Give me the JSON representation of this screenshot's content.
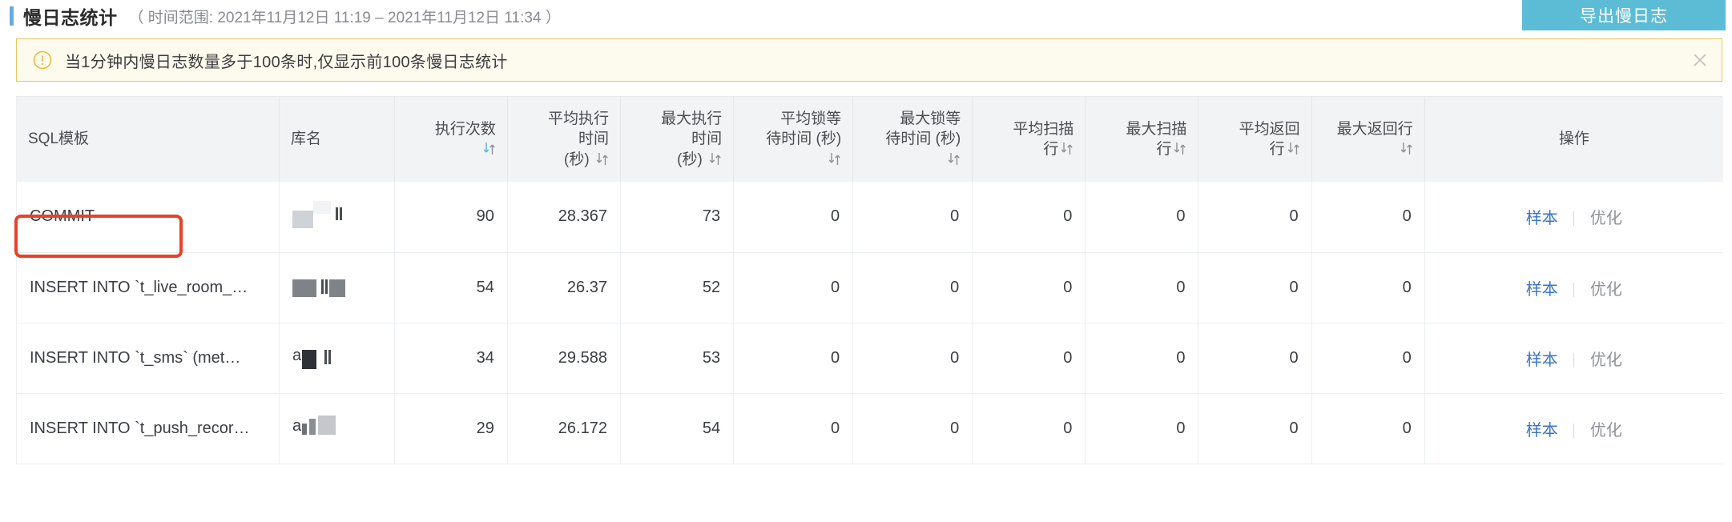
{
  "header": {
    "title": "慢日志统计",
    "time_range": "（ 时间范围: 2021年11月12日 11:19 – 2021年11月12日 11:34 ）",
    "export_label": "导出慢日志",
    "accent_color": "#6aa9e0",
    "export_button_color": "#5cbcd6"
  },
  "warning": {
    "icon": "exclamation-circle-icon",
    "text": "当1分钟内慢日志数量多于100条时,仅显示前100条慢日志统计",
    "close_icon": "close-icon",
    "background": "#fdfaee",
    "border_color": "#e6c75e",
    "icon_color": "#e8b93b"
  },
  "table": {
    "columns": [
      {
        "label": "SQL模板",
        "align": "left",
        "sortable": false,
        "sort_state": "none"
      },
      {
        "label": "库名",
        "align": "left",
        "sortable": false,
        "sort_state": "none"
      },
      {
        "label": "执行次数",
        "align": "right",
        "sortable": true,
        "sort_state": "desc"
      },
      {
        "label": "平均执行时间(秒)",
        "align": "right",
        "sortable": true,
        "sort_state": "none"
      },
      {
        "label": "最大执行时间(秒)",
        "align": "right",
        "sortable": true,
        "sort_state": "none"
      },
      {
        "label": "平均锁等待时间 (秒)",
        "align": "right",
        "sortable": true,
        "sort_state": "none"
      },
      {
        "label": "最大锁等待时间 (秒)",
        "align": "right",
        "sortable": true,
        "sort_state": "none"
      },
      {
        "label": "平均扫描行",
        "align": "right",
        "sortable": true,
        "sort_state": "none"
      },
      {
        "label": "最大扫描行",
        "align": "right",
        "sortable": true,
        "sort_state": "none"
      },
      {
        "label": "平均返回行",
        "align": "right",
        "sortable": true,
        "sort_state": "none"
      },
      {
        "label": "最大返回行",
        "align": "right",
        "sortable": true,
        "sort_state": "none"
      },
      {
        "label": "操作",
        "align": "center",
        "sortable": false,
        "sort_state": "none"
      }
    ],
    "column_lines": {
      "avg_exec_time_l1": "平均执行",
      "avg_exec_time_l2": "时间",
      "avg_exec_time_l3": "(秒)",
      "max_exec_time_l1": "最大执行",
      "max_exec_time_l2": "时间",
      "max_exec_time_l3": "(秒)",
      "avg_lock_l1": "平均锁等",
      "avg_lock_l2": "待时间 (秒)",
      "max_lock_l1": "最大锁等",
      "max_lock_l2": "待时间 (秒)",
      "avg_scan_l1": "平均扫描",
      "avg_scan_l2": "行",
      "max_scan_l1": "最大扫描",
      "max_scan_l2": "行",
      "avg_ret_l1": "平均返回",
      "avg_ret_l2": "行",
      "max_ret_l1": "最大返回行"
    },
    "actions": {
      "sample_label": "样本",
      "optimize_label": "优化",
      "sample_color": "#3b74c4",
      "optimize_color": "#8f9398"
    },
    "rows": [
      {
        "sql_template": "COMMIT",
        "db_name": "",
        "exec_count": "90",
        "avg_exec_time": "28.367",
        "max_exec_time": "73",
        "avg_lock_wait": "0",
        "max_lock_wait": "0",
        "avg_scan_rows": "0",
        "max_scan_rows": "0",
        "avg_return_rows": "0",
        "max_return_rows": "0",
        "highlighted": true
      },
      {
        "sql_template": "INSERT INTO `t_live_room_…",
        "db_name": "",
        "exec_count": "54",
        "avg_exec_time": "26.37",
        "max_exec_time": "52",
        "avg_lock_wait": "0",
        "max_lock_wait": "0",
        "avg_scan_rows": "0",
        "max_scan_rows": "0",
        "avg_return_rows": "0",
        "max_return_rows": "0",
        "highlighted": false
      },
      {
        "sql_template": "INSERT INTO `t_sms` (met…",
        "db_name": "a",
        "exec_count": "34",
        "avg_exec_time": "29.588",
        "max_exec_time": "53",
        "avg_lock_wait": "0",
        "max_lock_wait": "0",
        "avg_scan_rows": "0",
        "max_scan_rows": "0",
        "avg_return_rows": "0",
        "max_return_rows": "0",
        "highlighted": false
      },
      {
        "sql_template": "INSERT INTO `t_push_recor…",
        "db_name": "a",
        "exec_count": "29",
        "avg_exec_time": "26.172",
        "max_exec_time": "54",
        "avg_lock_wait": "0",
        "max_lock_wait": "0",
        "avg_scan_rows": "0",
        "max_scan_rows": "0",
        "avg_return_rows": "0",
        "max_return_rows": "0",
        "highlighted": false
      }
    ]
  },
  "annotation": {
    "type": "red-rectangle-highlight",
    "color": "#e8412a",
    "targets": "COMMIT"
  }
}
